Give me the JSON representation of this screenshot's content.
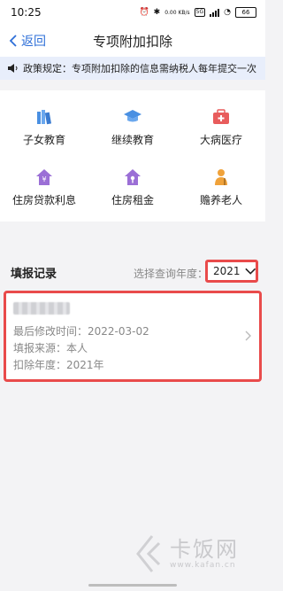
{
  "status_bar": {
    "time": "10:25",
    "battery": "66",
    "speed": "0.00 KB/s",
    "network": "5G"
  },
  "nav": {
    "back_label": "返回",
    "title": "专项附加扣除"
  },
  "banner": {
    "text": "政策规定：专项附加扣除的信息需纳税人每年提交一次"
  },
  "deductions": [
    {
      "label": "子女教育",
      "icon": "books-icon",
      "color": "#4a90e2"
    },
    {
      "label": "继续教育",
      "icon": "graduation-cap-icon",
      "color": "#4a90e2"
    },
    {
      "label": "大病医疗",
      "icon": "medical-kit-icon",
      "color": "#e85c5c"
    },
    {
      "label": "住房贷款利息",
      "icon": "house-loan-icon",
      "color": "#9b6fd6"
    },
    {
      "label": "住房租金",
      "icon": "house-rent-icon",
      "color": "#9b6fd6"
    },
    {
      "label": "赡养老人",
      "icon": "elderly-icon",
      "color": "#f0a23a"
    }
  ],
  "records": {
    "title": "填报记录",
    "year_label": "选择查询年度：",
    "selected_year": "2021"
  },
  "record_card": {
    "modified_label": "最后修改时间：",
    "modified_value": "2022-03-02",
    "source_label": "填报来源：",
    "source_value": "本人",
    "year_label": "扣除年度：",
    "year_value": "2021年"
  },
  "watermark": {
    "main": "卡饭网",
    "sub": "www.kafan.cn"
  },
  "colors": {
    "accent": "#2e6fd8",
    "highlight": "#e94b4b",
    "banner_bg": "#e8eefb"
  }
}
